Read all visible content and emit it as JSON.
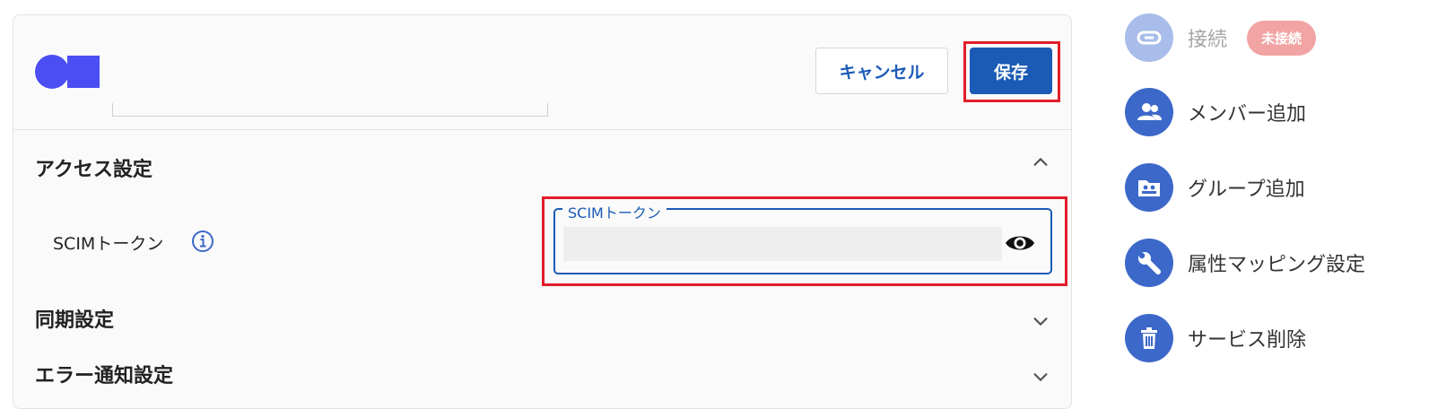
{
  "toolbar": {
    "cancel_label": "キャンセル",
    "save_label": "保存"
  },
  "sections": {
    "access": {
      "title": "アクセス設定",
      "expanded": true
    },
    "sync": {
      "title": "同期設定",
      "expanded": false
    },
    "error_notify": {
      "title": "エラー通知設定",
      "expanded": false
    }
  },
  "scim": {
    "label": "SCIMトークン",
    "field_label": "SCIMトークン",
    "value": ""
  },
  "sidebar": {
    "items": [
      {
        "label": "接続",
        "badge": "未接続",
        "icon": "link-icon",
        "disabled": true
      },
      {
        "label": "メンバー追加",
        "icon": "people-icon"
      },
      {
        "label": "グループ追加",
        "icon": "group-folder-icon"
      },
      {
        "label": "属性マッピング設定",
        "icon": "wrench-icon"
      },
      {
        "label": "サービス削除",
        "icon": "trash-icon"
      }
    ]
  },
  "colors": {
    "primary": "#1a5bb5",
    "logo": "#4b4ef2",
    "highlight": "#e11d2a",
    "badge": "#f2a3a3"
  }
}
